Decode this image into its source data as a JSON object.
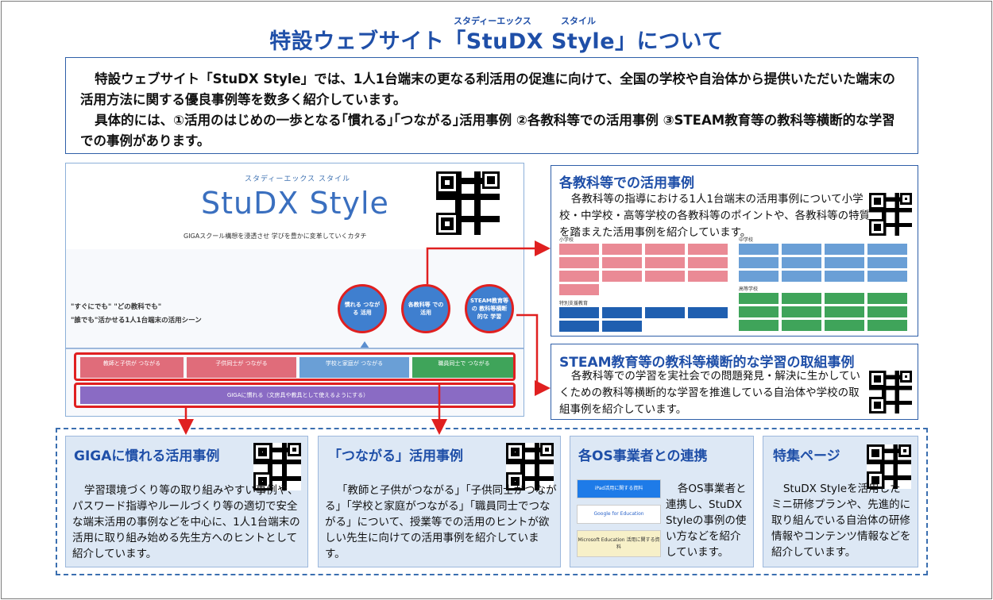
{
  "title": {
    "ruby_left": "スタディーエックス",
    "ruby_right": "スタイル",
    "text": "特設ウェブサイト「StuDX Style」について"
  },
  "intro": {
    "p1": "特設ウェブサイト「StuDX Style」では、1人1台端末の更なる利活用の促進に向けて、全国の学校や自治体から提供いただいた端末の活用方法に関する優良事例等を数多く紹介しています。",
    "p2": "具体的には、①活用のはじめの一歩となる｢慣れる｣｢つながる｣活用事例 ②各教科等での活用事例 ③STEAM教育等の教科等横断的な学習での事例があります。"
  },
  "screenshot": {
    "ruby": "スタディーエックス スタイル",
    "logo": "StuDX Style",
    "tagline": "GIGAスクール構想を浸透させ 学びを豊かに変革していくカタチ",
    "line1": "\"すぐにでも\" \"どの教科でも\"",
    "line2": "\"誰でも\"活かせる1人1台端末の活用シーン",
    "circles": [
      "慣れる つながる 活用",
      "各教科等 での活用",
      "STEAM教育等の 教科等横断的な 学習"
    ],
    "chips": [
      "教師と子供が つながる",
      "子供同士が つながる",
      "学校と家庭が つながる",
      "職員同士で つながる"
    ],
    "giga_bar": "GIGAに慣れる（文房具や教具として使えるようにする）"
  },
  "subjects": {
    "heading": "各教科等での活用事例",
    "text": "各教科等の指導における1人1台端末の活用事例について小学校・中学校・高等学校の各教科等のポイントや、各教科等の特質を踏まえた活用事例を紹介しています。",
    "label_elem": "小学校",
    "label_junior": "中学校",
    "label_high": "高等学校",
    "label_special": "特別支援教育"
  },
  "steam": {
    "heading": "STEAM教育等の教科等横断的な学習の取組事例",
    "text": "各教科等での学習を実社会での問題発見・解決に生かしていくための教科等横断的な学習を推進している自治体や学校の取組事例を紹介しています。"
  },
  "giga": {
    "heading": "GIGAに慣れる活用事例",
    "text": "学習環境づくり等の取り組みやすい事例や、パスワード指導やルールづくり等の適切で安全な端末活用の事例などを中心に、1人1台端末の活用に取り組み始める先生方へのヒントとして紹介しています。"
  },
  "tsunagaru": {
    "heading": "「つながる」活用事例",
    "text": "「教師と子供がつながる」「子供同士がつながる」「学校と家庭がつながる」「職員同士でつながる」について、授業等での活用のヒントが欲しい先生に向けての活用事例を紹介しています。"
  },
  "os": {
    "heading": "各OS事業者との連携",
    "text": "各OS事業者と連携し、StuDX Styleの事例の使い方などを紹介しています。",
    "logo1": "iPad活用に関する資料",
    "logo2": "Google for Education",
    "logo3": "Microsoft Education 活用に関する資料"
  },
  "feature": {
    "heading": "特集ページ",
    "text": "StuDX Styleを活用したミニ研修プランや、先進的に取り組んでいる自治体の研修情報やコンテンツ情報などを紹介しています。"
  },
  "colors": {
    "accent_blue": "#1f4fa8",
    "red": "#e02020",
    "panel_bg": "#dde8f5"
  }
}
